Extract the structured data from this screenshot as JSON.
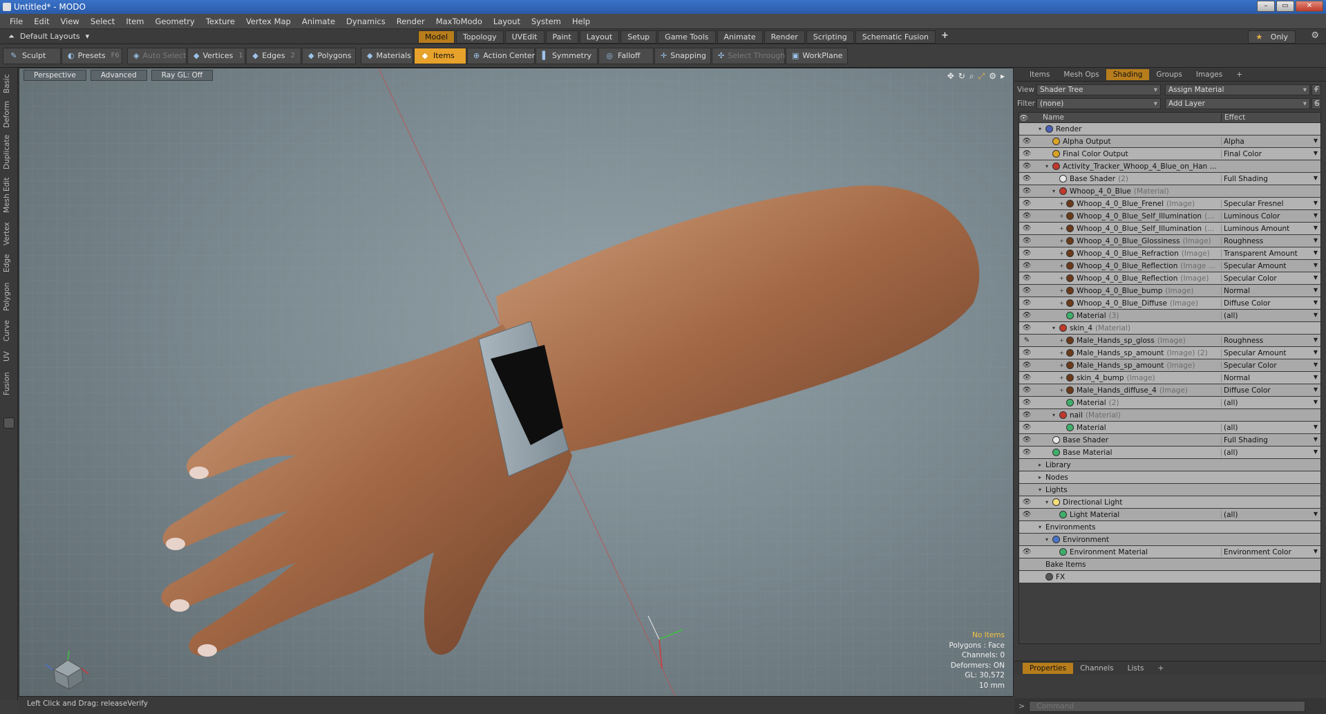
{
  "window": {
    "title": "Untitled* - MODO",
    "controls": [
      "–",
      "▭",
      "✕"
    ]
  },
  "menu": [
    "File",
    "Edit",
    "View",
    "Select",
    "Item",
    "Geometry",
    "Texture",
    "Vertex Map",
    "Animate",
    "Dynamics",
    "Render",
    "MaxToModo",
    "Layout",
    "System",
    "Help"
  ],
  "layout": {
    "default_label": "Default Layouts",
    "tabs": [
      "Model",
      "Topology",
      "UVEdit",
      "Paint",
      "Layout",
      "Setup",
      "Game Tools",
      "Animate",
      "Render",
      "Scripting",
      "Schematic Fusion"
    ],
    "active_tab": "Model",
    "plus": "+",
    "only_label": "Only"
  },
  "toolbar": {
    "sculpt": "Sculpt",
    "presets": "Presets",
    "presets_key": "F6",
    "auto_select": "Auto Select",
    "vertices": "Vertices",
    "vertices_key": "1",
    "edges": "Edges",
    "edges_key": "2",
    "polygons": "Polygons",
    "materials": "Materials",
    "items": "Items",
    "action_center": "Action Center",
    "symmetry": "Symmetry",
    "falloff": "Falloff",
    "snapping": "Snapping",
    "select_through": "Select Through",
    "workplane": "WorkPlane"
  },
  "left_tabs": [
    "Basic",
    "Deform",
    "Duplicate",
    "Mesh Edit",
    "Vertex",
    "Edge",
    "Polygon",
    "Curve",
    "UV",
    "Fusion"
  ],
  "viewport": {
    "view_mode": "Perspective",
    "shading": "Advanced",
    "raygl": "Ray GL: Off",
    "hud": [
      "No Items",
      "Polygons : Face",
      "Channels: 0",
      "Deformers: ON",
      "GL: 30,572",
      "10 mm"
    ]
  },
  "status": {
    "text": "Left Click and Drag:  releaseVerify"
  },
  "right_panel": {
    "tabs": [
      "Items",
      "Mesh Ops",
      "Shading",
      "Groups",
      "Images"
    ],
    "active_tab": "Shading",
    "plus": "+",
    "view_label": "View",
    "view_value": "Shader Tree",
    "assign_material": "Assign Material",
    "f_btn": "F",
    "filter_label": "Filter",
    "filter_value": "(none)",
    "add_layer": "Add Layer",
    "s_btn": "S",
    "columns": {
      "name": "Name",
      "effect": "Effect"
    },
    "rows": [
      {
        "name": "Render",
        "effect": "",
        "depth": 0,
        "arrow": "▾",
        "icon": "#4a5fb8",
        "eye": false
      },
      {
        "name": "Alpha Output",
        "effect": "Alpha",
        "depth": 1,
        "arrow": "",
        "icon": "#d9a326",
        "eye": true
      },
      {
        "name": "Final Color Output",
        "effect": "Final Color",
        "depth": 1,
        "arrow": "",
        "icon": "#d9a326",
        "eye": true
      },
      {
        "name": "Activity_Tracker_Whoop_4_Blue_on_Han ...",
        "effect": "",
        "depth": 1,
        "arrow": "▾",
        "icon": "#c0392b",
        "eye": true
      },
      {
        "name": "Base Shader",
        "tag": "(2)",
        "effect": "Full Shading",
        "depth": 2,
        "arrow": "",
        "icon": "#e8e8e8",
        "eye": true
      },
      {
        "name": "Whoop_4_0_Blue",
        "tag": "(Material)",
        "effect": "",
        "depth": 2,
        "arrow": "▾",
        "icon": "#c0392b",
        "eye": true
      },
      {
        "name": "Whoop_4_0_Blue_Frenel",
        "tag": "(Image)",
        "effect": "Specular Fresnel",
        "depth": 3,
        "arrow": "+",
        "icon": "#6b3a1a",
        "eye": true
      },
      {
        "name": "Whoop_4_0_Blue_Self_Illumination",
        "tag": "(...",
        "effect": "Luminous Color",
        "depth": 3,
        "arrow": "+",
        "icon": "#6b3a1a",
        "eye": true
      },
      {
        "name": "Whoop_4_0_Blue_Self_Illumination",
        "tag": "(...",
        "effect": "Luminous Amount",
        "depth": 3,
        "arrow": "+",
        "icon": "#6b3a1a",
        "eye": true
      },
      {
        "name": "Whoop_4_0_Blue_Glossiness",
        "tag": "(Image)",
        "effect": "Roughness",
        "depth": 3,
        "arrow": "+",
        "icon": "#6b3a1a",
        "eye": true
      },
      {
        "name": "Whoop_4_0_Blue_Refraction",
        "tag": "(Image)",
        "effect": "Transparent Amount",
        "depth": 3,
        "arrow": "+",
        "icon": "#6b3a1a",
        "eye": true
      },
      {
        "name": "Whoop_4_0_Blue_Reflection",
        "tag": "(Image ...",
        "effect": "Specular Amount",
        "depth": 3,
        "arrow": "+",
        "icon": "#6b3a1a",
        "eye": true
      },
      {
        "name": "Whoop_4_0_Blue_Reflection",
        "tag": "(Image)",
        "effect": "Specular Color",
        "depth": 3,
        "arrow": "+",
        "icon": "#6b3a1a",
        "eye": true
      },
      {
        "name": "Whoop_4_0_Blue_bump",
        "tag": "(Image)",
        "effect": "Normal",
        "depth": 3,
        "arrow": "+",
        "icon": "#6b3a1a",
        "eye": true
      },
      {
        "name": "Whoop_4_0_Blue_Diffuse",
        "tag": "(Image)",
        "effect": "Diffuse Color",
        "depth": 3,
        "arrow": "+",
        "icon": "#6b3a1a",
        "eye": true
      },
      {
        "name": "Material",
        "tag": "(3)",
        "effect": "(all)",
        "depth": 3,
        "arrow": "",
        "icon": "#3fae6a",
        "eye": true
      },
      {
        "name": "skin_4",
        "tag": "(Material)",
        "effect": "",
        "depth": 2,
        "arrow": "▾",
        "icon": "#c0392b",
        "eye": true
      },
      {
        "name": "Male_Hands_sp_gloss",
        "tag": "(Image)",
        "effect": "Roughness",
        "depth": 3,
        "arrow": "+",
        "icon": "#6b3a1a",
        "eye": true,
        "eye_brush": true
      },
      {
        "name": "Male_Hands_sp_amount",
        "tag": "(Image) (2)",
        "effect": "Specular Amount",
        "depth": 3,
        "arrow": "+",
        "icon": "#6b3a1a",
        "eye": true
      },
      {
        "name": "Male_Hands_sp_amount",
        "tag": "(Image)",
        "effect": "Specular Color",
        "depth": 3,
        "arrow": "+",
        "icon": "#6b3a1a",
        "eye": true
      },
      {
        "name": "skin_4_bump",
        "tag": "(Image)",
        "effect": "Normal",
        "depth": 3,
        "arrow": "+",
        "icon": "#6b3a1a",
        "eye": true
      },
      {
        "name": "Male_Hands_diffuse_4",
        "tag": "(Image)",
        "effect": "Diffuse Color",
        "depth": 3,
        "arrow": "+",
        "icon": "#6b3a1a",
        "eye": true
      },
      {
        "name": "Material",
        "tag": "(2)",
        "effect": "(all)",
        "depth": 3,
        "arrow": "",
        "icon": "#3fae6a",
        "eye": true
      },
      {
        "name": "nail",
        "tag": "(Material)",
        "effect": "",
        "depth": 2,
        "arrow": "▾",
        "icon": "#c0392b",
        "eye": true
      },
      {
        "name": "Material",
        "effect": "(all)",
        "depth": 3,
        "arrow": "",
        "icon": "#3fae6a",
        "eye": true
      },
      {
        "name": "Base Shader",
        "effect": "Full Shading",
        "depth": 1,
        "arrow": "",
        "icon": "#e8e8e8",
        "eye": true
      },
      {
        "name": "Base Material",
        "effect": "(all)",
        "depth": 1,
        "arrow": "",
        "icon": "#3fae6a",
        "eye": true
      },
      {
        "name": "Library",
        "effect": "",
        "depth": 0,
        "arrow": "▸",
        "icon": "",
        "eye": false
      },
      {
        "name": "Nodes",
        "effect": "",
        "depth": 0,
        "arrow": "▸",
        "icon": "",
        "eye": false
      },
      {
        "name": "Lights",
        "effect": "",
        "depth": 0,
        "arrow": "▾",
        "icon": "",
        "eye": false
      },
      {
        "name": "Directional Light",
        "effect": "",
        "depth": 1,
        "arrow": "▾",
        "icon": "#f5e07a",
        "eye": true
      },
      {
        "name": "Light Material",
        "effect": "(all)",
        "depth": 2,
        "arrow": "",
        "icon": "#3fae6a",
        "eye": true
      },
      {
        "name": "Environments",
        "effect": "",
        "depth": 0,
        "arrow": "▾",
        "icon": "",
        "eye": false
      },
      {
        "name": "Environment",
        "effect": "",
        "depth": 1,
        "arrow": "▾",
        "icon": "#4a73c8",
        "eye": false
      },
      {
        "name": "Environment Material",
        "effect": "Environment Color",
        "depth": 2,
        "arrow": "",
        "icon": "#3fae6a",
        "eye": true
      },
      {
        "name": "Bake Items",
        "effect": "",
        "depth": 0,
        "arrow": "",
        "icon": "",
        "eye": false
      },
      {
        "name": "FX",
        "effect": "",
        "depth": 0,
        "arrow": "",
        "icon": "#555555",
        "eye": false
      }
    ]
  },
  "properties": {
    "tabs": [
      "Properties",
      "Channels",
      "Lists"
    ],
    "active_tab": "Properties",
    "plus": "+"
  },
  "command": {
    "placeholder": "Command"
  }
}
